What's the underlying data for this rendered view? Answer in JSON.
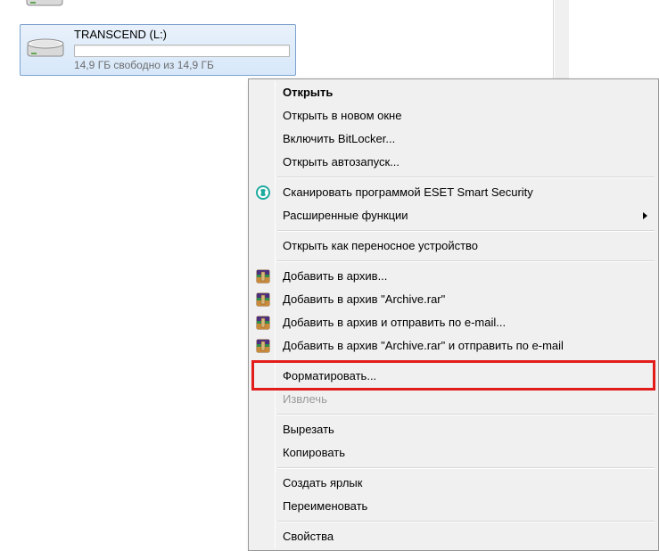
{
  "drive": {
    "label": "TRANSCEND (L:)",
    "free_text": "14,9 ГБ свободно из 14,9 ГБ"
  },
  "menu": {
    "open": "Открыть",
    "open_new": "Открыть в новом окне",
    "bitlocker": "Включить BitLocker...",
    "autoplay": "Открыть автозапуск...",
    "eset_scan": "Сканировать программой ESET Smart Security",
    "eset_more": "Расширенные функции",
    "portable": "Открыть как переносное устройство",
    "rar_add": "Добавить в архив...",
    "rar_add_named": "Добавить в архив \"Archive.rar\"",
    "rar_email": "Добавить в архив и отправить по e-mail...",
    "rar_named_email": "Добавить в архив \"Archive.rar\" и отправить по e-mail",
    "format": "Форматировать...",
    "eject": "Извлечь",
    "cut": "Вырезать",
    "copy": "Копировать",
    "shortcut": "Создать ярлык",
    "rename": "Переименовать",
    "properties": "Свойства"
  }
}
